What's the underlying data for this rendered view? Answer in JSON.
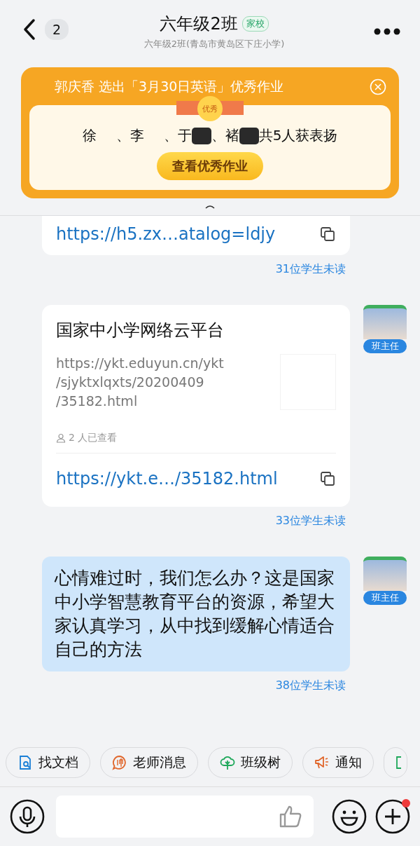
{
  "header": {
    "back_count": "2",
    "title": "六年级2班",
    "tag": "家校",
    "subtitle": "六年级2班(青岛市黄岛区下庄小学)"
  },
  "banner": {
    "title": "郭庆香 选出「3月30日英语」优秀作业",
    "badge": "优秀",
    "names": [
      {
        "name": "徐",
        "masked": false
      },
      {
        "name": "李",
        "masked": false
      },
      {
        "name": "于",
        "masked": true
      },
      {
        "name": "褚",
        "masked": true
      }
    ],
    "separator": "、",
    "summary": "共5人获表扬",
    "button": "查看优秀作业"
  },
  "messages": [
    {
      "kind": "link-tail",
      "link": "https://h5.zx…atalog=ldjy",
      "unread": "31位学生未读",
      "avatar": false
    },
    {
      "kind": "link-card",
      "title": "国家中小学网络云平台",
      "url": "https://ykt.eduyun.cn/ykt\n/sjyktxlqxts/20200409\n/35182.html",
      "views": "2 人已查看",
      "link": "https://ykt.e…/35182.html",
      "unread": "33位学生未读",
      "avatar": true,
      "role": "班主任"
    },
    {
      "kind": "text",
      "text": "心情难过时，我们怎么办？这是国家中小学智慧教育平台的资源，希望大家认真学习，从中找到缓解心情适合自己的方法",
      "unread": "38位学生未读",
      "avatar": true,
      "role": "班主任"
    }
  ],
  "quick_actions": [
    {
      "kind": "doc",
      "label": "找文档"
    },
    {
      "kind": "teacher",
      "label": "老师消息"
    },
    {
      "kind": "tree",
      "label": "班级树"
    },
    {
      "kind": "notice",
      "label": "通知"
    },
    {
      "kind": "more"
    }
  ],
  "input_bar": {
    "plus_badge": true
  }
}
